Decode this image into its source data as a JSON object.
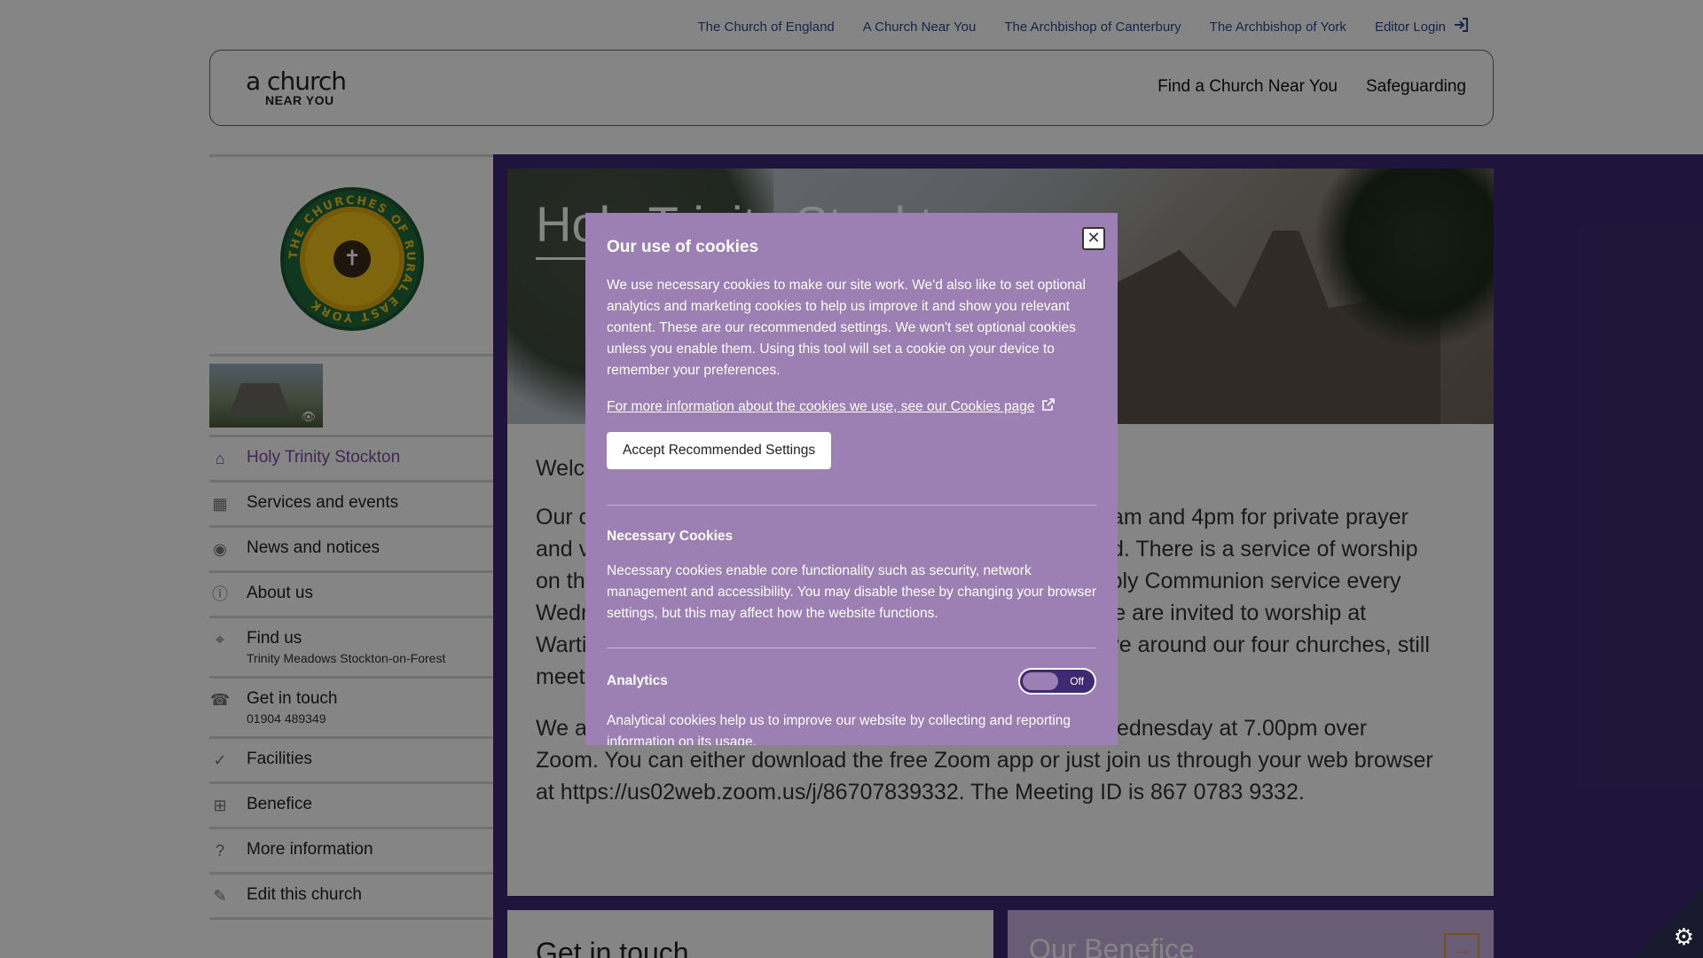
{
  "top_links": [
    {
      "label": "The Church of England"
    },
    {
      "label": "A Church Near You"
    },
    {
      "label": "The Archbishop of Canterbury"
    },
    {
      "label": "The Archbishop of York"
    },
    {
      "label": "Editor Login"
    }
  ],
  "header": {
    "logo_line1": "a church",
    "logo_line2": "NEAR YOU",
    "nav": [
      "Find a Church Near You",
      "Safeguarding"
    ]
  },
  "sidebar": {
    "crest_text": "THE CHURCHES OF RURAL EAST YORK",
    "items": [
      {
        "label": "Holy Trinity Stockton",
        "icon": "home-icon",
        "active": true
      },
      {
        "label": "Services and events",
        "icon": "calendar-icon"
      },
      {
        "label": "News and notices",
        "icon": "broadcast-icon"
      },
      {
        "label": "About us",
        "icon": "info-icon"
      },
      {
        "label": "Find us",
        "sub": "Trinity Meadows Stockton-on-Forest",
        "icon": "location-pin-icon"
      },
      {
        "label": "Get in touch",
        "sub": "01904 489349",
        "icon": "phone-icon"
      },
      {
        "label": "Facilities",
        "icon": "check-circle-icon"
      },
      {
        "label": "Benefice",
        "icon": "grid-circle-icon"
      },
      {
        "label": "More information",
        "icon": "question-circle-icon"
      },
      {
        "label": "Edit this church",
        "icon": "pencil-icon"
      }
    ]
  },
  "hero": {
    "title": "Holy Trinity Stockton"
  },
  "content": {
    "welcome": "Welc",
    "paragraph1_left": "Our c",
    "paragraph1_right": "0am and 4pm for private prayer",
    "line2_left": "and v",
    "line2_right": "nd. There is a service of worship",
    "line3_left": "on th",
    "line3_right": "Holy Communion service every",
    "line4_left": "Wedr",
    "line4_right": "we are invited to worship at",
    "line5_left": "Warti",
    "line5_right": "ove around our four churches, still",
    "line6_left": "meet",
    "paragraph2_line1": "We a",
    "paragraph2_line1_right": "Wednesday at 7.00pm over",
    "paragraph2_line2": "Zoom. You can either download the free Zoom app or just join us through your web browser",
    "paragraph2_line3": "at https://us02web.zoom.us/j/86707839332. The Meeting ID is 867 0783 9332."
  },
  "cards": {
    "get_in_touch": "Get in touch",
    "our_benefice": "Our Benefice"
  },
  "cookie_modal": {
    "title": "Our use of cookies",
    "intro": "We use necessary cookies to make our site work. We'd also like to set optional analytics and marketing cookies to help us improve it and show you relevant content. These are our recommended settings. We won't set optional cookies unless you enable them. Using this tool will set a cookie on your device to remember your preferences.",
    "more_info_link": "For more information about the cookies we use, see our Cookies page",
    "accept_button": "Accept Recommended Settings",
    "necessary_title": "Necessary Cookies",
    "necessary_text": "Necessary cookies enable core functionality such as security, network management and accessibility. You may disable these by changing your browser settings, but this may affect how the website functions.",
    "analytics_title": "Analytics",
    "analytics_toggle": "Off",
    "analytics_text": "Analytical cookies help us to improve our website by collecting and reporting information on its usage."
  },
  "colors": {
    "brand_purple": "#3d2a73",
    "modal_purple": "#9c80b3",
    "link_blue": "#2e4a8a"
  }
}
